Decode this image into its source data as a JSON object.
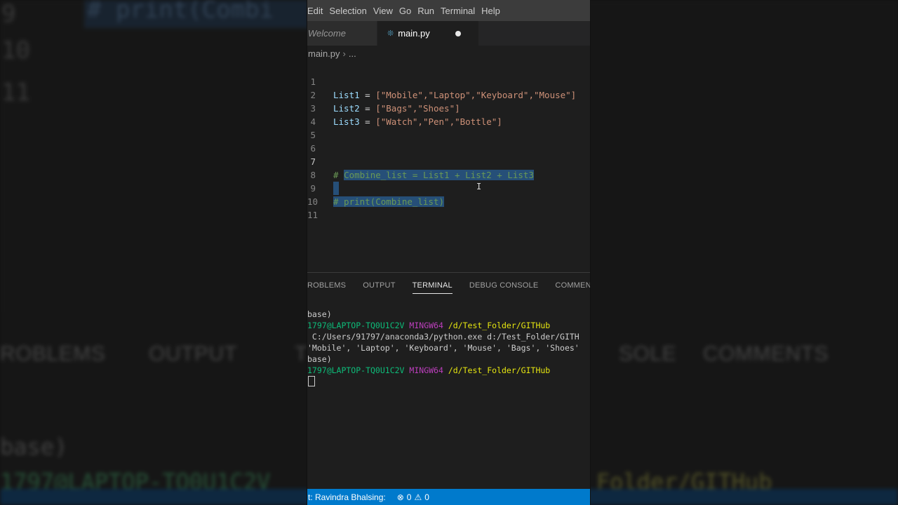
{
  "menubar": [
    "Edit",
    "Selection",
    "View",
    "Go",
    "Run",
    "Terminal",
    "Help"
  ],
  "tabs": {
    "welcome": "Welcome",
    "main": "main.py"
  },
  "breadcrumb": {
    "file": "main.py",
    "ellipsis": "..."
  },
  "editor": {
    "lines": [
      {
        "num": "1",
        "var": "List1",
        "op": " = ",
        "items": "[\"Mobile\",\"Laptop\",\"Keyboard\",\"Mouse\"]"
      },
      {
        "num": "2",
        "var": "List2",
        "op": " = ",
        "items": "[\"Bags\",\"Shoes\"]"
      },
      {
        "num": "3",
        "var": "List3",
        "op": " = ",
        "items": "[\"Watch\",\"Pen\",\"Bottle\"]"
      },
      {
        "num": "4"
      },
      {
        "num": "5"
      },
      {
        "num": "6"
      },
      {
        "num": "7",
        "comment_hash": "# ",
        "comment_sel": "Combine_list = List1 + List2 + List3"
      },
      {
        "num": "8"
      },
      {
        "num": "9",
        "comment_sel": "# print(Combine_list)"
      },
      {
        "num": "10"
      },
      {
        "num": "11"
      }
    ]
  },
  "panel": {
    "tabs": [
      "ROBLEMS",
      "OUTPUT",
      "TERMINAL",
      "DEBUG CONSOLE",
      "COMMENTS"
    ],
    "active": "TERMINAL"
  },
  "terminal": {
    "l1": "base)",
    "l2_user": "1797@LAPTOP-TQ0U1C2V",
    "l2_host": "MINGW64",
    "l2_path": "/d/Test_Folder/GITHub",
    "l3": " C:/Users/91797/anaconda3/python.exe d:/Test_Folder/GITH",
    "l4": "'Mobile', 'Laptop', 'Keyboard', 'Mouse', 'Bags', 'Shoes'",
    "l5": "base)",
    "l6_user": "1797@LAPTOP-TQ0U1C2V",
    "l6_host": "MINGW64",
    "l6_path": "/d/Test_Folder/GITHub"
  },
  "status": {
    "user": "t: Ravindra Bhalsing:",
    "errors": "0",
    "warnings": "0"
  },
  "background": {
    "lines": [
      "9",
      "10",
      "11"
    ],
    "code": "# print(Combi",
    "tabs": [
      "ROBLEMS",
      "OUTPUT",
      "T",
      "SOLE",
      "COMMENTS"
    ],
    "term1": "base)",
    "term2": "1797@LAPTOP-TQ0U1C2V",
    "term3": "Folder/GITHub"
  },
  "colors": {
    "accent": "#007acc",
    "selection": "#264f78",
    "string": "#ce9178",
    "variable": "#9cdcfe",
    "comment": "#6a9955"
  }
}
